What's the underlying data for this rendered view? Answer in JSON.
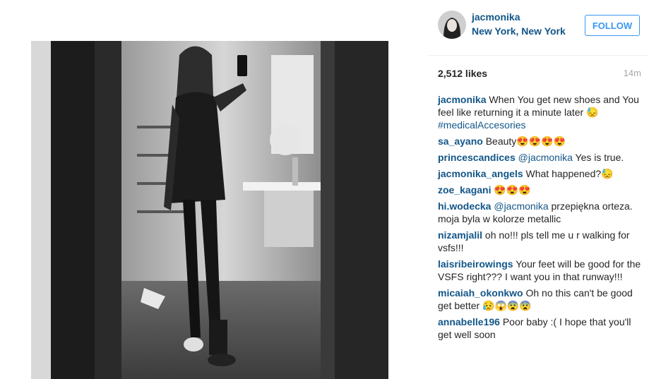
{
  "post": {
    "username": "jacmonika",
    "location": "New York, New York",
    "follow_label": "FOLLOW",
    "likes": "2,512 likes",
    "time": "14m"
  },
  "comments": [
    {
      "user": "jacmonika",
      "text": "When You get new shoes and You feel like returning it a minute later",
      "emoji": "😓",
      "hashtag": "#medicalAccesories"
    },
    {
      "user": "sa_ayano",
      "text": "Beauty",
      "emoji": "😍😍😍😍"
    },
    {
      "user": "princescandices",
      "mention": "@jacmonika",
      "text": "Yes is true."
    },
    {
      "user": "jacmonika_angels",
      "text": "What happened?",
      "emoji": "😓"
    },
    {
      "user": "zoe_kagani",
      "text": "",
      "emoji": "😍😍😍"
    },
    {
      "user": "hi.wodecka",
      "mention": "@jacmonika",
      "text": "przepiękna orteza. moja byla w kolorze metallic"
    },
    {
      "user": "nizamjalil",
      "text": "oh no!!! pls tell me u r walking for vsfs!!!"
    },
    {
      "user": "laisribeirowings",
      "text": "Your feet will be good for the VSFS right??? I want you in that runway!!!"
    },
    {
      "user": "micaiah_okonkwo",
      "text": "Oh no this can't be good get better",
      "emoji": "😥😱😨😨"
    },
    {
      "user": "annabelle196",
      "text": "Poor baby :( I hope that you'll get well soon"
    }
  ]
}
